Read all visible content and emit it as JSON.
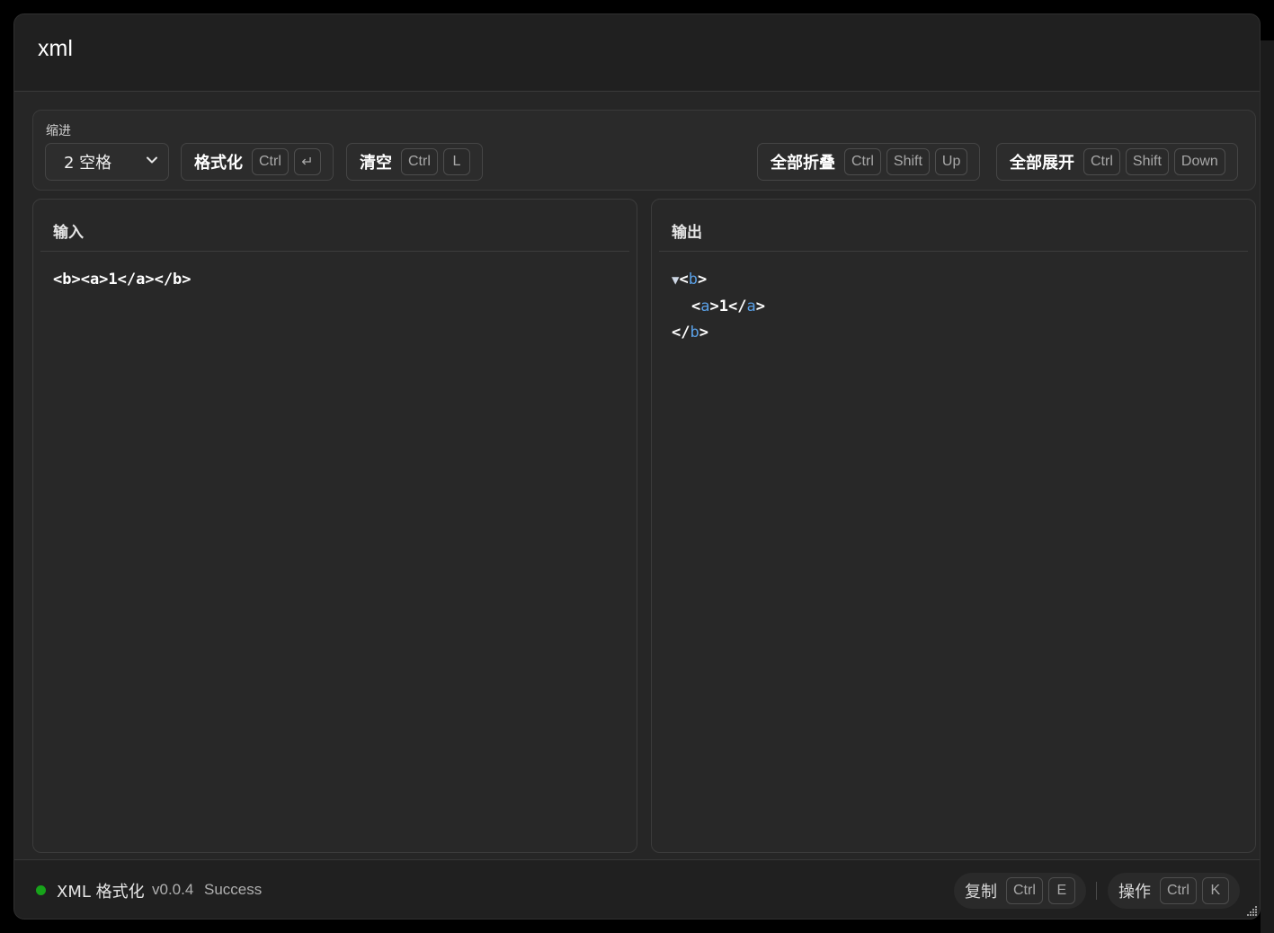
{
  "window": {
    "title": "xml"
  },
  "toolbar": {
    "indent_label": "缩进",
    "indent_select_value": "2 空格",
    "format": {
      "label": "格式化",
      "keys": [
        "Ctrl",
        "↵"
      ]
    },
    "clear": {
      "label": "清空",
      "keys": [
        "Ctrl",
        "L"
      ]
    },
    "collapse_all": {
      "label": "全部折叠",
      "keys": [
        "Ctrl",
        "Shift",
        "Up"
      ]
    },
    "expand_all": {
      "label": "全部展开",
      "keys": [
        "Ctrl",
        "Shift",
        "Down"
      ]
    }
  },
  "input_panel": {
    "title": "输入",
    "content": "<b><a>1</a></b>"
  },
  "output_panel": {
    "title": "输出",
    "tree": {
      "toggle": "▼",
      "open_lt": "<",
      "root_tag": "b",
      "open_gt": ">",
      "child_lt": "<",
      "child_tag": "a",
      "child_gt": ">",
      "child_text": "1",
      "child_close_lt": "</",
      "child_close_tag": "a",
      "child_close_gt": ">",
      "close_lt": "</",
      "close_tag": "b",
      "close_gt": ">"
    }
  },
  "status_bar": {
    "app_name": "XML 格式化",
    "version": "v0.0.4",
    "status": "Success",
    "copy": {
      "label": "复制",
      "keys": [
        "Ctrl",
        "E"
      ]
    },
    "actions": {
      "label": "操作",
      "keys": [
        "Ctrl",
        "K"
      ]
    }
  },
  "colors": {
    "tag": "#5aa0e6",
    "status_dot": "#17a31a",
    "background": "#262626"
  }
}
